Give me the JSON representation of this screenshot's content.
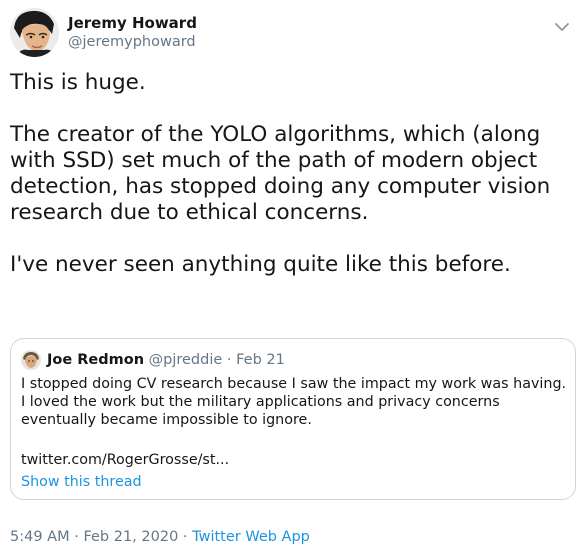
{
  "author": {
    "name": "Jeremy Howard",
    "handle": "@jeremyphoward"
  },
  "tweet": {
    "text": "This is huge.\n\nThe creator of the YOLO algorithms, which (along with SSD) set much of the path of modern object detection, has stopped doing any computer vision research due to ethical concerns.\n\nI've never seen anything quite like this before."
  },
  "quoted_tweet": {
    "name": "Joe Redmon",
    "handle": "@pjreddie",
    "separator": "·",
    "date": "Feb 21",
    "text": "I stopped doing CV research because I saw the impact my work was having. I loved the work but the military applications and privacy concerns eventually became impossible to ignore.",
    "link": "twitter.com/RogerGrosse/st...",
    "show_thread": "Show this thread"
  },
  "footer": {
    "time": "5:49 AM",
    "separator": "·",
    "date": "Feb 21, 2020",
    "source": "Twitter Web App"
  },
  "icons": {
    "menu": "chevron-down-icon",
    "avatar": "avatar",
    "quoted_avatar": "avatar"
  }
}
